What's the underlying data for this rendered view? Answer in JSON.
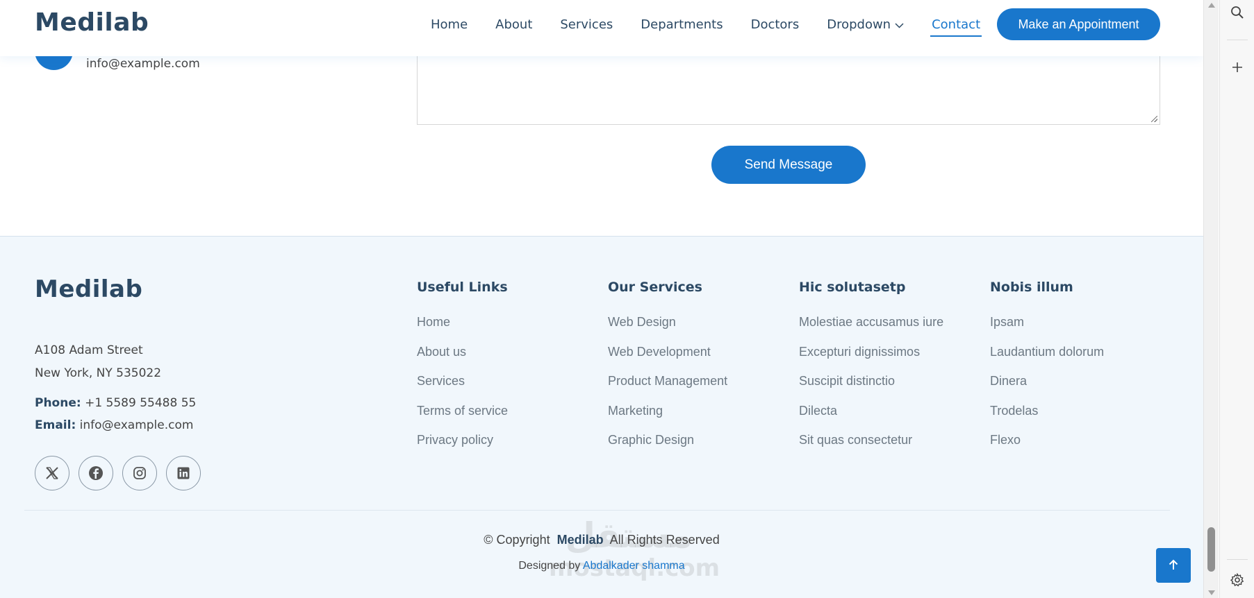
{
  "header": {
    "logo": "Medilab",
    "nav": [
      {
        "label": "Home",
        "active": false
      },
      {
        "label": "About",
        "active": false
      },
      {
        "label": "Services",
        "active": false
      },
      {
        "label": "Departments",
        "active": false
      },
      {
        "label": "Doctors",
        "active": false
      },
      {
        "label": "Dropdown",
        "active": false,
        "has_dropdown": true
      },
      {
        "label": "Contact",
        "active": true
      }
    ],
    "cta_label": "Make an Appointment"
  },
  "contact": {
    "email": "info@example.com",
    "send_label": "Send Message"
  },
  "footer": {
    "logo": "Medilab",
    "address_line1": "A108 Adam Street",
    "address_line2": "New York, NY 535022",
    "phone_label": "Phone:",
    "phone_value": "+1 5589 55488 55",
    "email_label": "Email:",
    "email_value": "info@example.com",
    "socials": [
      "x-icon",
      "facebook-icon",
      "instagram-icon",
      "linkedin-icon"
    ],
    "columns": [
      {
        "title": "Useful Links",
        "links": [
          "Home",
          "About us",
          "Services",
          "Terms of service",
          "Privacy policy"
        ]
      },
      {
        "title": "Our Services",
        "links": [
          "Web Design",
          "Web Development",
          "Product Management",
          "Marketing",
          "Graphic Design"
        ]
      },
      {
        "title": "Hic solutasetp",
        "links": [
          "Molestiae accusamus iure",
          "Excepturi dignissimos",
          "Suscipit distinctio",
          "Dilecta",
          "Sit quas consectetur"
        ]
      },
      {
        "title": "Nobis illum",
        "links": [
          "Ipsam",
          "Laudantium dolorum",
          "Dinera",
          "Trodelas",
          "Flexo"
        ]
      }
    ],
    "copyright_prefix": "© Copyright",
    "copyright_brand": "Medilab",
    "copyright_suffix": "All Rights Reserved",
    "designed_prefix": "Designed by",
    "designed_author": "Abdalkader shamma"
  },
  "watermark": {
    "arabic": "مستقل",
    "latin": "mostaql.com"
  },
  "side_panel": {
    "icons": [
      "search-icon",
      "plus-icon",
      "settings-icon"
    ]
  },
  "colors": {
    "accent": "#1977cc",
    "heading": "#2c4964",
    "footer_bg": "#f1f7fc"
  }
}
